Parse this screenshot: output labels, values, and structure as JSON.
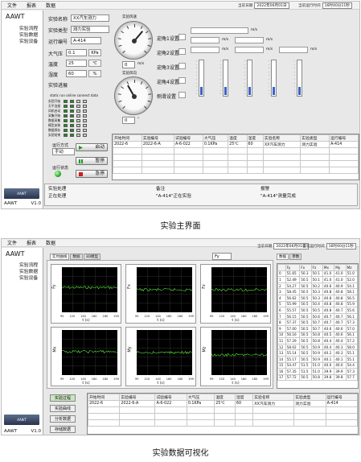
{
  "menu": [
    "文件",
    "报表",
    "数据"
  ],
  "dates": {
    "date_label": "当前日期",
    "date_value": "2022年06月01日",
    "time_label": "当前运行时间",
    "time_value": "16时40分11秒"
  },
  "sidebar": {
    "root": "AAWT",
    "items": [
      "实验流程",
      "实验数据",
      "实验设备"
    ],
    "logo": "AAWT",
    "app": "AAWT",
    "version": "V1.0"
  },
  "main": {
    "labels": [
      "实验名称",
      "实验类型",
      "运行编号",
      "大气压",
      "温度",
      "湿度",
      "实验进展"
    ],
    "values": [
      "XX汽车测力",
      "测力实验",
      "A-414",
      "0.1",
      "25",
      "60"
    ],
    "units": [
      "KPa",
      "℃",
      "%"
    ],
    "gauge_titles": [
      "实验风速",
      "实验风向"
    ],
    "angle_labels": [
      "迎角1设置",
      "迎角2设置",
      "迎角3设置",
      "迎角4设置"
    ],
    "slide_label": "侧滑设置",
    "unit_ms": "m/s",
    "unit_deg": "°",
    "zero": "0",
    "chk_header": "static run online connect data",
    "checks": [
      "实验开始",
      "天平连接",
      "风机启动",
      "采集开始",
      "数据采集",
      "模型安装",
      "数据保存",
      "实验结束"
    ],
    "run_mode_label": "运行方式",
    "run_mode_value": "手动",
    "status_label": "运行状态",
    "buttons": [
      "启动",
      "暂停",
      "急停"
    ]
  },
  "table": {
    "headers": [
      "开始时间",
      "实验编号",
      "试验编号",
      "大气压",
      "温度",
      "湿度",
      "实验名称",
      "实验类型",
      "运行编号"
    ],
    "row": [
      "2022-6",
      "2022-6-A",
      "A-6-022",
      "0.1KPa",
      "25℃",
      "60",
      "XX汽车测力",
      "测力实验",
      "A-414"
    ]
  },
  "bottom": {
    "s1": "实验处理",
    "s1v": "正在处理",
    "s2": "备注",
    "s2v": "\"A-414\"正在实验",
    "s3": "报警",
    "s3v": "\"A-414\"测量完成"
  },
  "caption1": "实验主界面",
  "viz": {
    "tabs": [
      "实时曲线",
      "数据",
      "3D模型"
    ],
    "search_value": "Fy",
    "right_tabs": [
      "数据",
      "参数"
    ],
    "ylabels": [
      "Fy",
      "Fx",
      "Fz",
      "Mx",
      "My",
      "Mz"
    ],
    "xlabel": "t (s)",
    "xticks": [
      "95",
      "120",
      "140",
      "160",
      "180",
      "199"
    ],
    "ycols": [
      "Fy",
      "Fx",
      "Fz",
      "Mx",
      "My",
      "Mz"
    ],
    "rows": [
      [
        "51.65",
        "50.3",
        "50.1",
        "41.0",
        "41.0",
        "51.0"
      ],
      [
        "52.49",
        "50.5",
        "50.1",
        "41.0",
        "41.0",
        "52.0"
      ],
      [
        "54.27",
        "50.5",
        "50.2",
        "40.6",
        "40.9",
        "54.1"
      ],
      [
        "58.45",
        "50.5",
        "50.3",
        "40.8",
        "40.8",
        "58.1"
      ],
      [
        "56.62",
        "50.5",
        "50.3",
        "40.8",
        "40.8",
        "56.5"
      ],
      [
        "55.99",
        "50.5",
        "50.4",
        "40.8",
        "40.8",
        "55.9"
      ],
      [
        "55.57",
        "50.5",
        "50.5",
        "40.8",
        "40.7",
        "55.6"
      ],
      [
        "56.15",
        "50.5",
        "50.6",
        "40.7",
        "40.7",
        "56.1"
      ],
      [
        "57.37",
        "50.5",
        "50.7",
        "40.7",
        "40.7",
        "57.3"
      ],
      [
        "57.00",
        "50.5",
        "50.7",
        "40.6",
        "40.6",
        "57.0"
      ],
      [
        "56.16",
        "50.5",
        "50.8",
        "40.5",
        "40.6",
        "56.1"
      ],
      [
        "57.29",
        "50.5",
        "50.8",
        "40.4",
        "40.4",
        "57.2"
      ],
      [
        "58.02",
        "50.5",
        "50.9",
        "40.4",
        "40.3",
        "58.0"
      ],
      [
        "55.14",
        "50.5",
        "50.9",
        "40.2",
        "40.3",
        "55.1"
      ],
      [
        "55.17",
        "50.5",
        "50.9",
        "40.1",
        "40.1",
        "55.1"
      ],
      [
        "54.47",
        "51.5",
        "51.0",
        "40.0",
        "40.0",
        "54.4"
      ],
      [
        "57.35",
        "51.5",
        "51.0",
        "39.9",
        "39.9",
        "57.3"
      ],
      [
        "57.72",
        "50.5",
        "50.8",
        "39.8",
        "39.8",
        "57.7"
      ]
    ],
    "side_buttons": [
      "实验过程",
      "实验曲线",
      "分析数据",
      "存储数据"
    ],
    "caption": "实验数据可视化"
  }
}
